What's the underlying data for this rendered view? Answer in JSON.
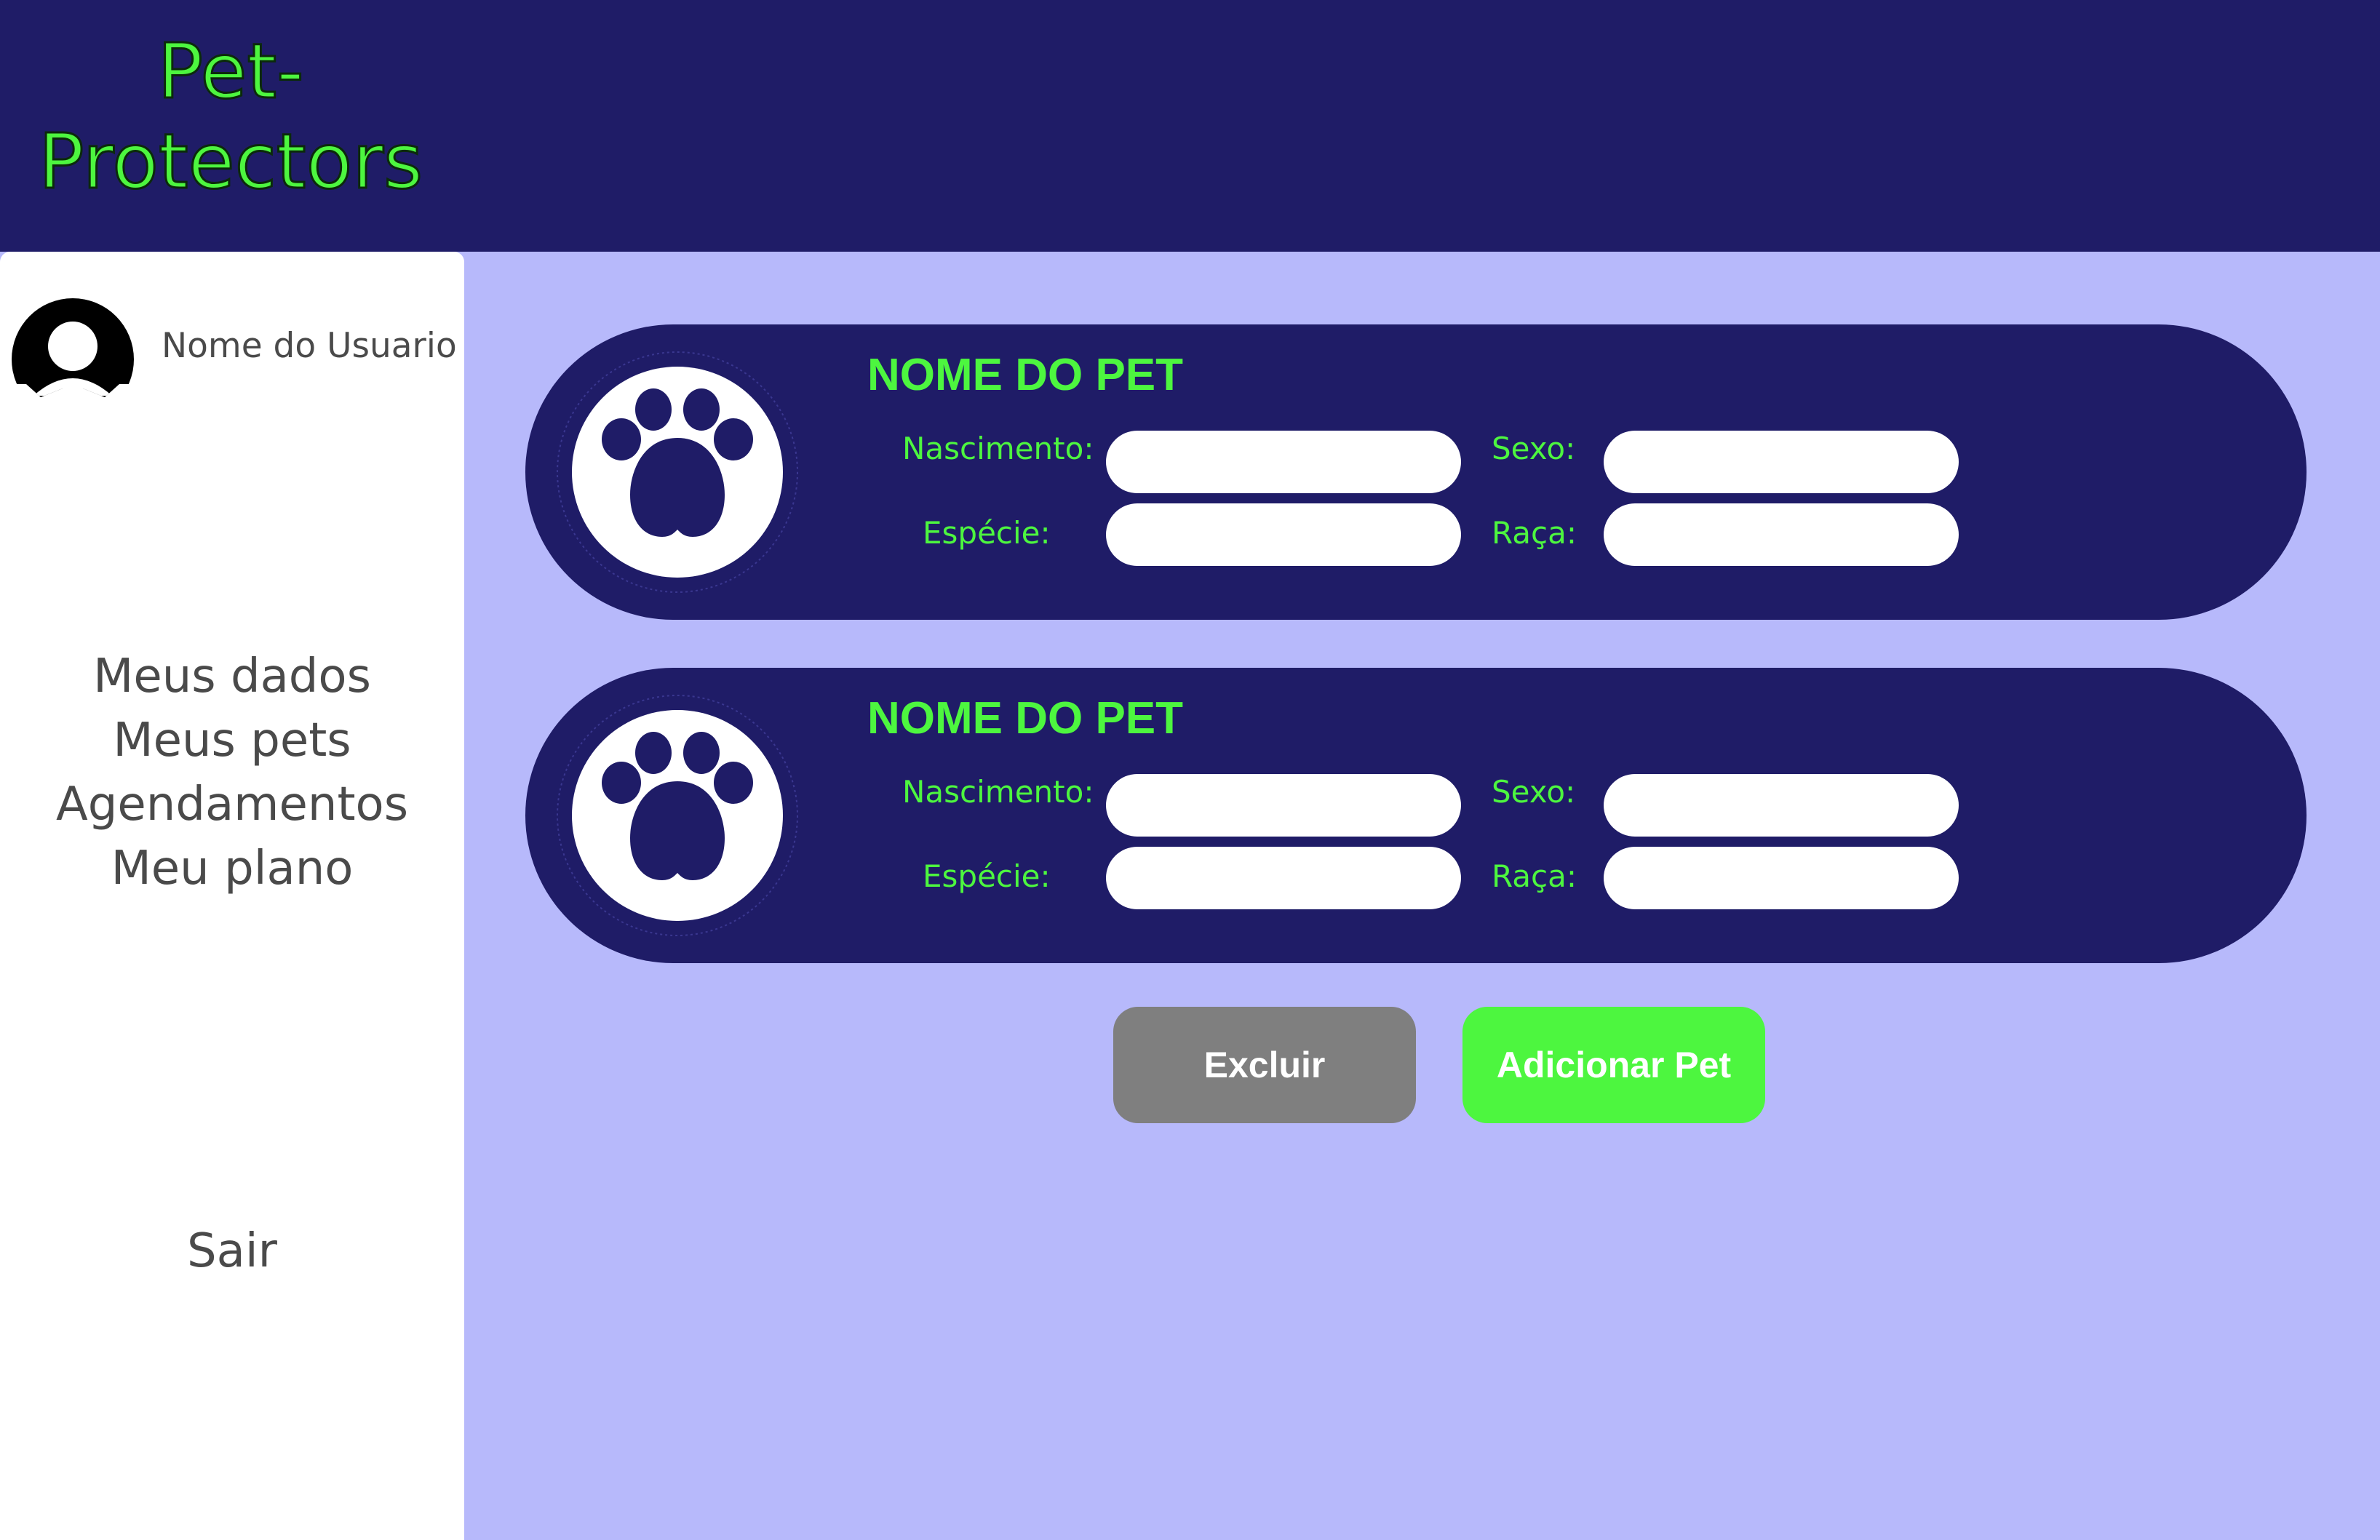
{
  "header": {
    "logo_line1": "Pet-",
    "logo_line2": "Protectors"
  },
  "sidebar": {
    "user_name": "Nome do Usuario",
    "nav": [
      "Meus dados",
      "Meus pets",
      "Agendamentos",
      "Meu plano"
    ],
    "logout": "Sair"
  },
  "pets": [
    {
      "name": "NOME DO PET",
      "labels": {
        "birth": "Nascimento:",
        "sex": "Sexo:",
        "species": "Espécie:",
        "breed": "Raça:"
      },
      "values": {
        "birth": "",
        "sex": "",
        "species": "",
        "breed": ""
      }
    },
    {
      "name": "NOME DO PET",
      "labels": {
        "birth": "Nascimento:",
        "sex": "Sexo:",
        "species": "Espécie:",
        "breed": "Raça:"
      },
      "values": {
        "birth": "",
        "sex": "",
        "species": "",
        "breed": ""
      }
    }
  ],
  "actions": {
    "delete_label": "Excluir",
    "add_label": "Adicionar Pet"
  },
  "colors": {
    "header_bg": "#1F1C67",
    "content_bg": "#B7B9FB",
    "accent_green": "#4DF63F",
    "delete_gray": "#7F7F7F",
    "card_bg": "#1F1C67"
  },
  "icons": {
    "avatar": "user-avatar-icon",
    "pet": "paw-icon"
  }
}
